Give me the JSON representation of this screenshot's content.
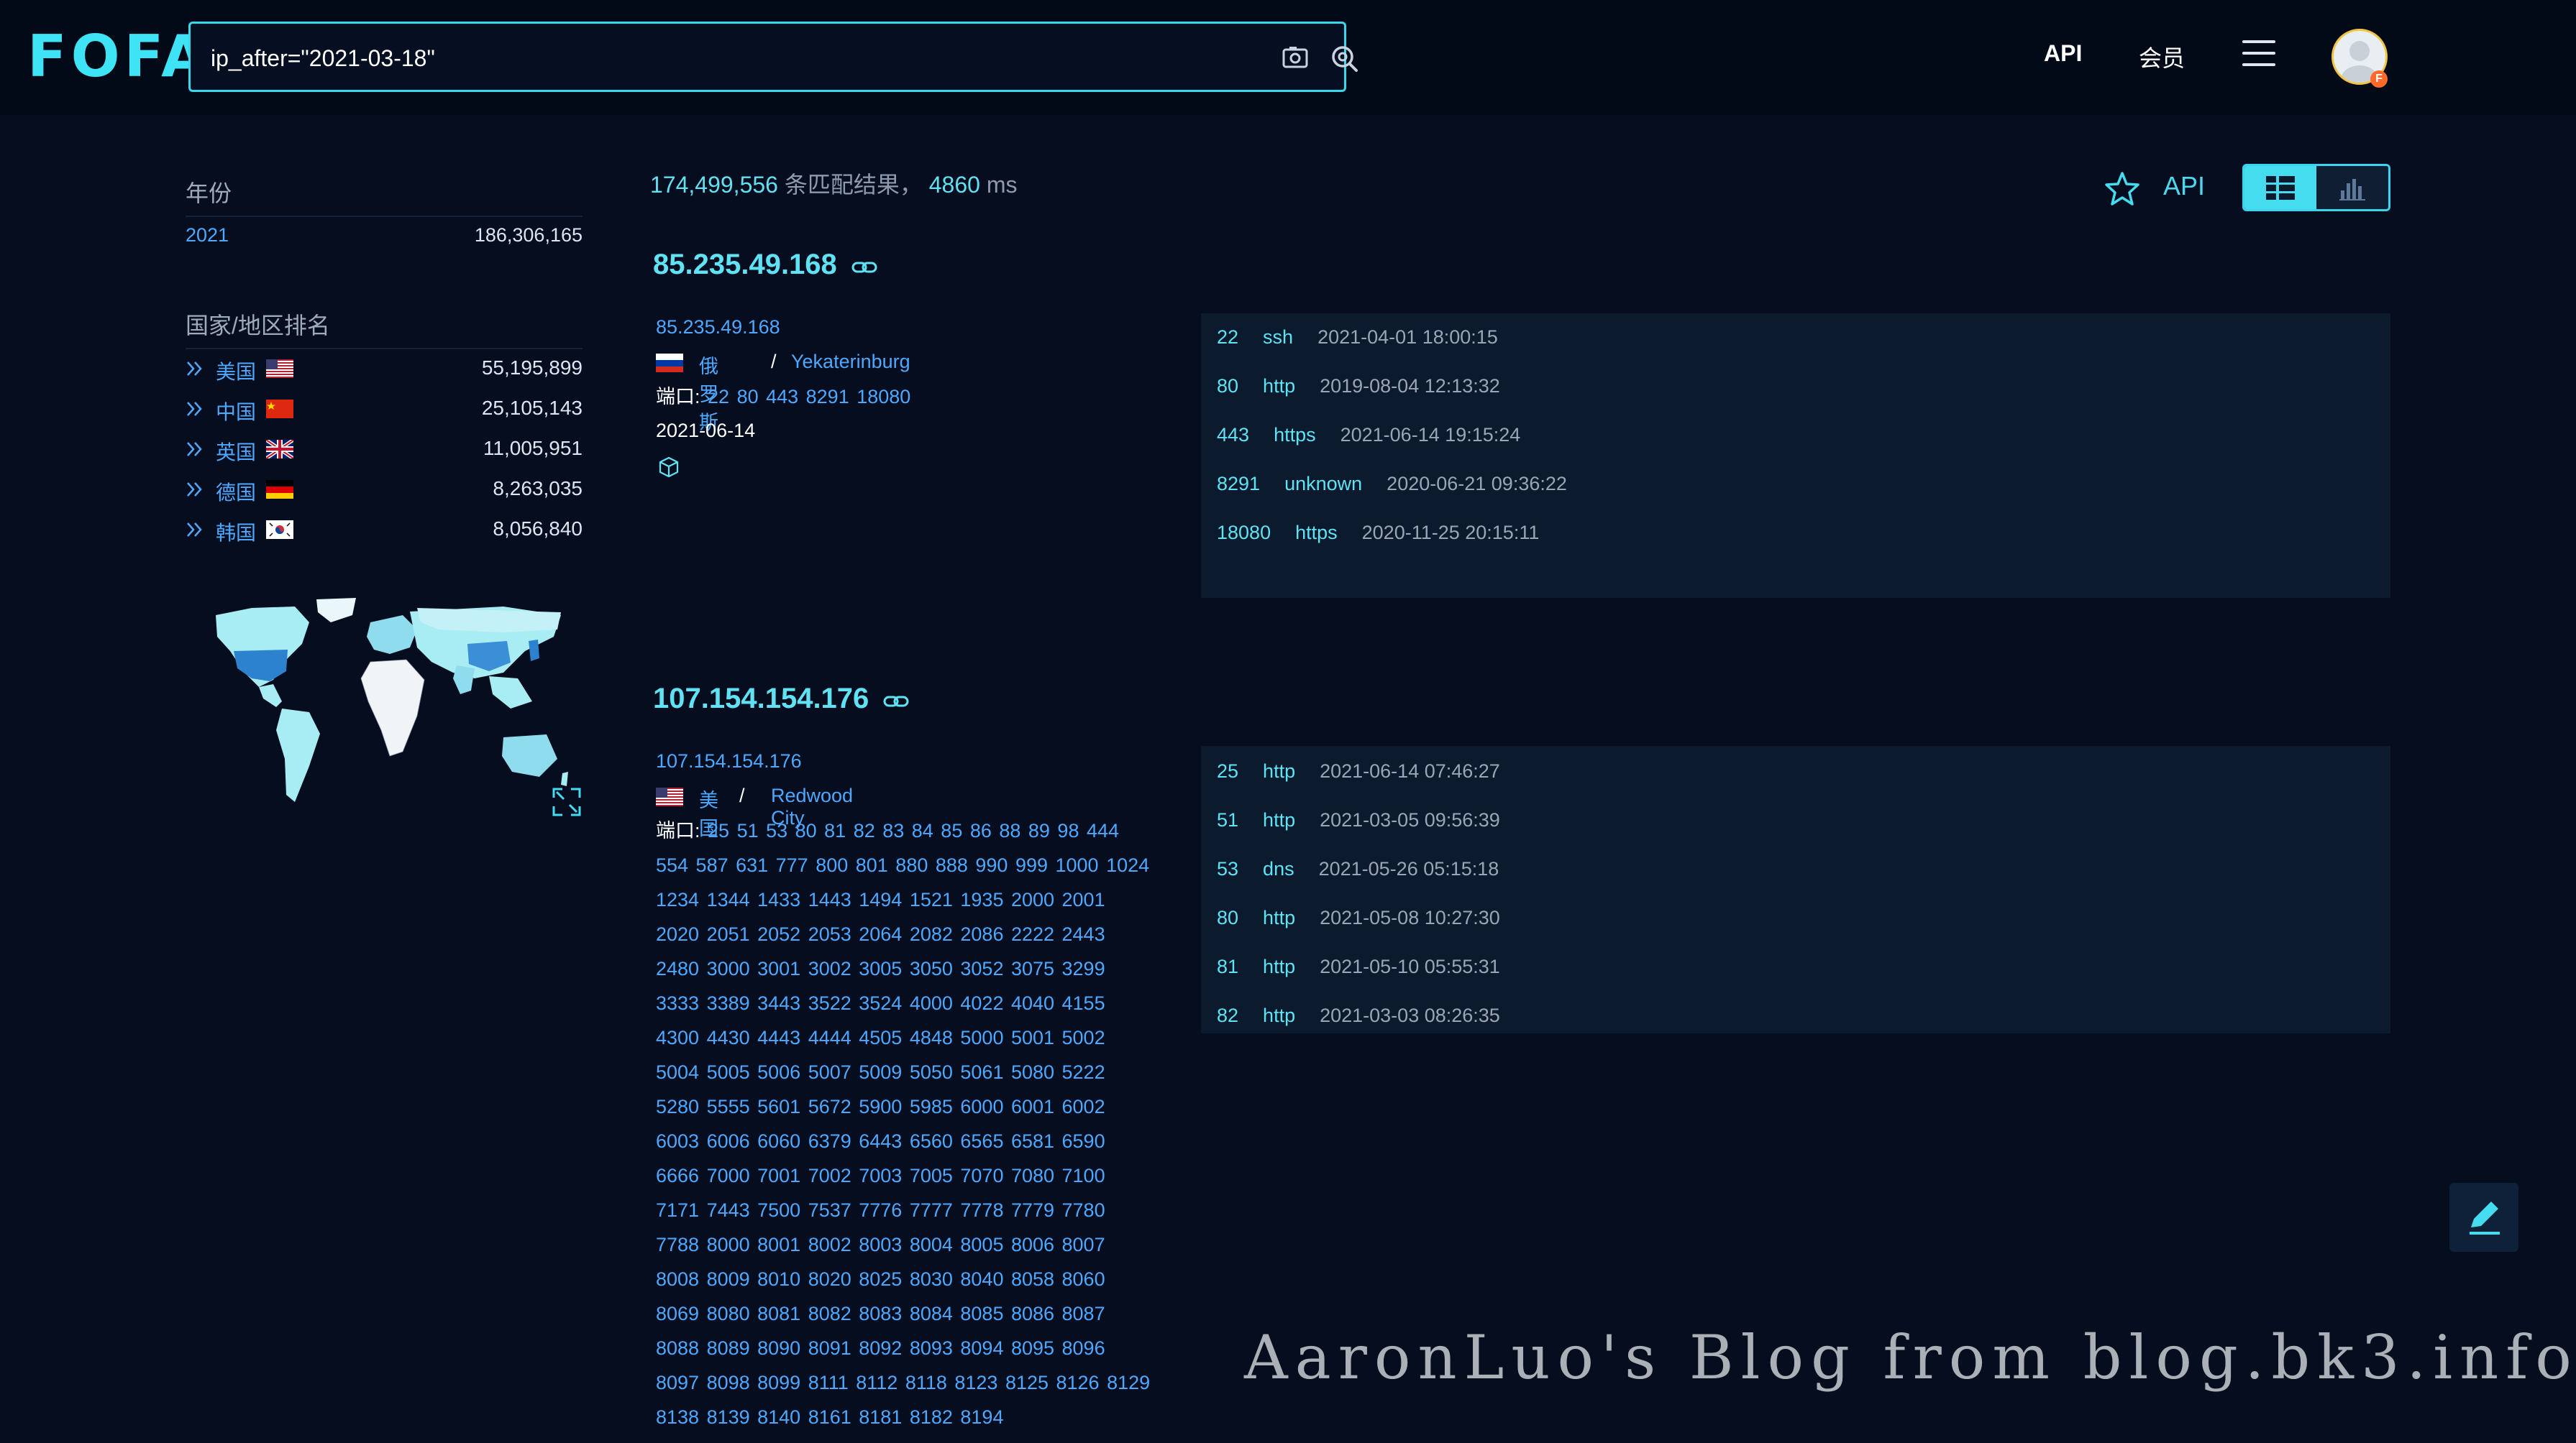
{
  "header": {
    "logo": "FOFA",
    "search_value": "ip_after=\"2021-03-18\"",
    "nav_api": "API",
    "nav_member": "会员",
    "avatar_badge": "F"
  },
  "sidebar": {
    "year_title": "年份",
    "years": [
      {
        "year": "2021",
        "count": "186,306,165"
      }
    ],
    "country_title": "国家/地区排名",
    "countries": [
      {
        "name": "美国",
        "count": "55,195,899"
      },
      {
        "name": "中国",
        "count": "25,105,143"
      },
      {
        "name": "英国",
        "count": "11,005,951"
      },
      {
        "name": "德国",
        "count": "8,263,035"
      },
      {
        "name": "韩国",
        "count": "8,056,840"
      }
    ]
  },
  "summary": {
    "count": "174,499,556",
    "count_suffix": "条匹配结果，",
    "time": "4860",
    "time_unit": "ms"
  },
  "toolbar": {
    "api_label": "API"
  },
  "results": [
    {
      "ip": "85.235.49.168",
      "host": "85.235.49.168",
      "country": "俄罗斯",
      "separator": "/",
      "city": "Yekaterinburg",
      "ports_label": "端口:",
      "ports": "22 80 443 8291 18080",
      "date": "2021-06-14",
      "services": [
        {
          "port": "22",
          "protocol": "ssh",
          "time": "2021-04-01 18:00:15"
        },
        {
          "port": "80",
          "protocol": "http",
          "time": "2019-08-04 12:13:32"
        },
        {
          "port": "443",
          "protocol": "https",
          "time": "2021-06-14 19:15:24"
        },
        {
          "port": "8291",
          "protocol": "unknown",
          "time": "2020-06-21 09:36:22"
        },
        {
          "port": "18080",
          "protocol": "https",
          "time": "2020-11-25 20:15:11"
        }
      ]
    },
    {
      "ip": "107.154.154.176",
      "host": "107.154.154.176",
      "country": "美国",
      "separator": "/",
      "city": "Redwood City",
      "ports_label": "端口:",
      "ports": "25 51 53 80 81 82 83 84 85 86 88 89 98 444 554 587 631 777 800 801 880 888 990 999 1000 1024 1234 1344 1433 1443 1494 1521 1935 2000 2001 2020 2051 2052 2053 2064 2082 2086 2222 2443 2480 3000 3001 3002 3005 3050 3052 3075 3299 3333 3389 3443 3522 3524 4000 4022 4040 4155 4300 4430 4443 4444 4505 4848 5000 5001 5002 5004 5005 5006 5007 5009 5050 5061 5080 5222 5280 5555 5601 5672 5900 5985 6000 6001 6002 6003 6006 6060 6379 6443 6560 6565 6581 6590 6666 7000 7001 7002 7003 7005 7070 7080 7100 7171 7443 7500 7537 7776 7777 7778 7779 7780 7788 8000 8001 8002 8003 8004 8005 8006 8007 8008 8009 8010 8020 8025 8030 8040 8058 8060 8069 8080 8081 8082 8083 8084 8085 8086 8087 8088 8089 8090 8091 8092 8093 8094 8095 8096 8097 8098 8099 8111 8112 8118 8123 8125 8126 8129 8138 8139 8140 8161 8181 8182 8194",
      "services": [
        {
          "port": "25",
          "protocol": "http",
          "time": "2021-06-14 07:46:27"
        },
        {
          "port": "51",
          "protocol": "http",
          "time": "2021-03-05 09:56:39"
        },
        {
          "port": "53",
          "protocol": "dns",
          "time": "2021-05-26 05:15:18"
        },
        {
          "port": "80",
          "protocol": "http",
          "time": "2021-05-08 10:27:30"
        },
        {
          "port": "81",
          "protocol": "http",
          "time": "2021-05-10 05:55:31"
        },
        {
          "port": "82",
          "protocol": "http",
          "time": "2021-03-03 08:26:35"
        }
      ]
    }
  ],
  "watermark": "AaronLuo's Blog from blog.bk3.info",
  "colors": {
    "accent": "#45dcef",
    "link": "#4ea8ff",
    "background": "#050d1e",
    "panel": "#0b1a2d"
  }
}
